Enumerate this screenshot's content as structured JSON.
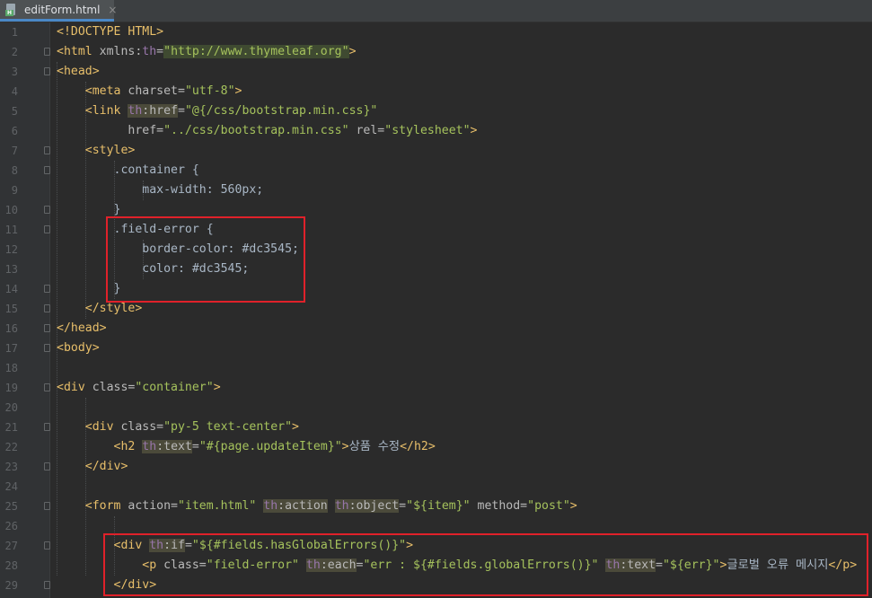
{
  "tab": {
    "title": "editForm.html",
    "icon": "html-file-icon",
    "close": "×"
  },
  "lines": [
    {
      "n": "1",
      "segs": [
        {
          "c": "t-tag",
          "t": "<!DOCTYPE HTML>"
        }
      ]
    },
    {
      "n": "2",
      "segs": [
        {
          "c": "t-tag",
          "t": "<html "
        },
        {
          "c": "t-attr",
          "t": "xmlns:"
        },
        {
          "c": "t-ns-plain",
          "t": "th"
        },
        {
          "c": "t-attr",
          "t": "="
        },
        {
          "c": "t-url",
          "t": "\"http://www.thymeleaf.org\""
        },
        {
          "c": "t-tag",
          "t": ">"
        }
      ]
    },
    {
      "n": "3",
      "segs": [
        {
          "c": "t-tag",
          "t": "<head>"
        }
      ]
    },
    {
      "n": "4",
      "segs": [
        {
          "c": "t-txt",
          "t": "    "
        },
        {
          "c": "t-tag",
          "t": "<meta "
        },
        {
          "c": "t-attr",
          "t": "charset="
        },
        {
          "c": "t-val",
          "t": "\"utf-8\""
        },
        {
          "c": "t-tag",
          "t": ">"
        }
      ]
    },
    {
      "n": "5",
      "segs": [
        {
          "c": "t-txt",
          "t": "    "
        },
        {
          "c": "t-tag",
          "t": "<link "
        },
        {
          "c": "t-ns",
          "t": "th"
        },
        {
          "c": "t-attr t-th",
          "t": ":href"
        },
        {
          "c": "t-attr",
          "t": "="
        },
        {
          "c": "t-val",
          "t": "\"@{/css/bootstrap.min.css}\""
        }
      ]
    },
    {
      "n": "6",
      "segs": [
        {
          "c": "t-txt",
          "t": "          "
        },
        {
          "c": "t-attr",
          "t": "href="
        },
        {
          "c": "t-val",
          "t": "\"../css/bootstrap.min.css\""
        },
        {
          "c": "t-attr",
          "t": " rel="
        },
        {
          "c": "t-val",
          "t": "\"stylesheet\""
        },
        {
          "c": "t-tag",
          "t": ">"
        }
      ]
    },
    {
      "n": "7",
      "segs": [
        {
          "c": "t-txt",
          "t": "    "
        },
        {
          "c": "t-tag",
          "t": "<style>"
        }
      ]
    },
    {
      "n": "8",
      "segs": [
        {
          "c": "t-txt",
          "t": "        .container {"
        }
      ]
    },
    {
      "n": "9",
      "segs": [
        {
          "c": "t-txt",
          "t": "            max-width: 560px;"
        }
      ]
    },
    {
      "n": "10",
      "segs": [
        {
          "c": "t-txt",
          "t": "        }"
        }
      ]
    },
    {
      "n": "11",
      "segs": [
        {
          "c": "t-txt",
          "t": "        .field-error {"
        }
      ]
    },
    {
      "n": "12",
      "segs": [
        {
          "c": "t-txt",
          "t": "            border-color: #dc3545;"
        }
      ]
    },
    {
      "n": "13",
      "segs": [
        {
          "c": "t-txt",
          "t": "            color: #dc3545;"
        }
      ]
    },
    {
      "n": "14",
      "segs": [
        {
          "c": "t-txt",
          "t": "        }"
        }
      ]
    },
    {
      "n": "15",
      "segs": [
        {
          "c": "t-txt",
          "t": "    "
        },
        {
          "c": "t-tag",
          "t": "</style>"
        }
      ]
    },
    {
      "n": "16",
      "segs": [
        {
          "c": "t-tag",
          "t": "</head>"
        }
      ]
    },
    {
      "n": "17",
      "segs": [
        {
          "c": "t-tag",
          "t": "<body>"
        }
      ]
    },
    {
      "n": "18",
      "segs": []
    },
    {
      "n": "19",
      "segs": [
        {
          "c": "t-tag",
          "t": "<div "
        },
        {
          "c": "t-attr",
          "t": "class="
        },
        {
          "c": "t-val",
          "t": "\"container\""
        },
        {
          "c": "t-tag",
          "t": ">"
        }
      ]
    },
    {
      "n": "20",
      "segs": []
    },
    {
      "n": "21",
      "segs": [
        {
          "c": "t-txt",
          "t": "    "
        },
        {
          "c": "t-tag",
          "t": "<div "
        },
        {
          "c": "t-attr",
          "t": "class="
        },
        {
          "c": "t-val",
          "t": "\"py-5 text-center\""
        },
        {
          "c": "t-tag",
          "t": ">"
        }
      ]
    },
    {
      "n": "22",
      "segs": [
        {
          "c": "t-txt",
          "t": "        "
        },
        {
          "c": "t-tag",
          "t": "<h2 "
        },
        {
          "c": "t-ns",
          "t": "th"
        },
        {
          "c": "t-attr t-th",
          "t": ":text"
        },
        {
          "c": "t-attr",
          "t": "="
        },
        {
          "c": "t-val",
          "t": "\"#{page.updateItem}\""
        },
        {
          "c": "t-tag",
          "t": ">"
        },
        {
          "c": "t-txt",
          "t": "상품 수정"
        },
        {
          "c": "t-tag",
          "t": "</h2>"
        }
      ]
    },
    {
      "n": "23",
      "segs": [
        {
          "c": "t-txt",
          "t": "    "
        },
        {
          "c": "t-tag",
          "t": "</div>"
        }
      ]
    },
    {
      "n": "24",
      "segs": []
    },
    {
      "n": "25",
      "segs": [
        {
          "c": "t-txt",
          "t": "    "
        },
        {
          "c": "t-tag",
          "t": "<form "
        },
        {
          "c": "t-attr",
          "t": "action="
        },
        {
          "c": "t-val",
          "t": "\"item.html\""
        },
        {
          "c": "t-txt",
          "t": " "
        },
        {
          "c": "t-ns",
          "t": "th"
        },
        {
          "c": "t-attr t-th",
          "t": ":action"
        },
        {
          "c": "t-txt",
          "t": " "
        },
        {
          "c": "t-ns",
          "t": "th"
        },
        {
          "c": "t-attr t-th",
          "t": ":object"
        },
        {
          "c": "t-attr",
          "t": "="
        },
        {
          "c": "t-val",
          "t": "\"${item}\""
        },
        {
          "c": "t-attr",
          "t": " method="
        },
        {
          "c": "t-val",
          "t": "\"post\""
        },
        {
          "c": "t-tag",
          "t": ">"
        }
      ]
    },
    {
      "n": "26",
      "segs": []
    },
    {
      "n": "27",
      "segs": [
        {
          "c": "t-txt",
          "t": "        "
        },
        {
          "c": "t-tag",
          "t": "<div "
        },
        {
          "c": "t-ns",
          "t": "th"
        },
        {
          "c": "t-attr t-th",
          "t": ":if"
        },
        {
          "c": "t-attr",
          "t": "="
        },
        {
          "c": "t-val",
          "t": "\"${#fields.hasGlobalErrors()}\""
        },
        {
          "c": "t-tag",
          "t": ">"
        }
      ]
    },
    {
      "n": "28",
      "segs": [
        {
          "c": "t-txt",
          "t": "            "
        },
        {
          "c": "t-tag",
          "t": "<p "
        },
        {
          "c": "t-attr",
          "t": "class="
        },
        {
          "c": "t-val",
          "t": "\"field-error\""
        },
        {
          "c": "t-txt",
          "t": " "
        },
        {
          "c": "t-ns",
          "t": "th"
        },
        {
          "c": "t-attr t-th",
          "t": ":each"
        },
        {
          "c": "t-attr",
          "t": "="
        },
        {
          "c": "t-val",
          "t": "\"err : ${#fields.globalErrors()}\""
        },
        {
          "c": "t-txt",
          "t": " "
        },
        {
          "c": "t-ns",
          "t": "th"
        },
        {
          "c": "t-attr t-th",
          "t": ":text"
        },
        {
          "c": "t-attr",
          "t": "="
        },
        {
          "c": "t-val",
          "t": "\"${err}\""
        },
        {
          "c": "t-tag",
          "t": ">"
        },
        {
          "c": "t-txt",
          "t": "글로벌 오류 메시지"
        },
        {
          "c": "t-tag",
          "t": "</p>"
        }
      ]
    },
    {
      "n": "29",
      "segs": [
        {
          "c": "t-txt",
          "t": "        "
        },
        {
          "c": "t-tag",
          "t": "</div>"
        }
      ]
    }
  ]
}
